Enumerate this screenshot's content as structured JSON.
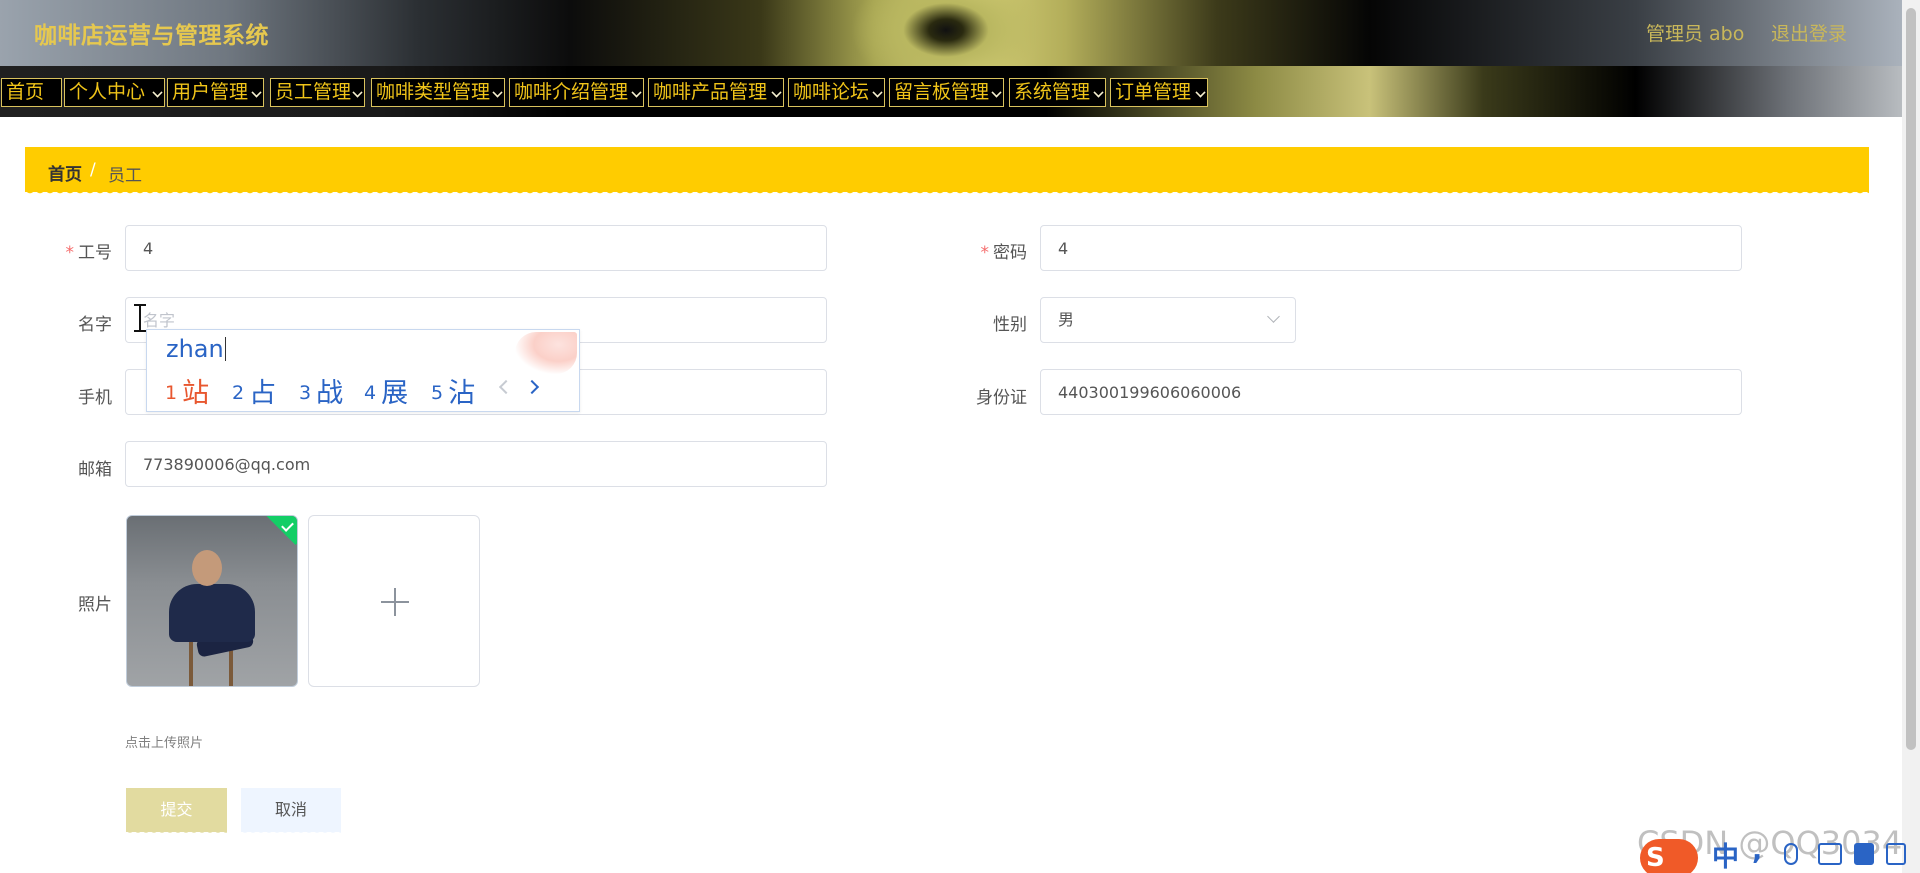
{
  "header": {
    "app_title": "咖啡店运营与管理系统",
    "admin_label": "管理员 abo",
    "logout_label": "退出登录"
  },
  "menu": {
    "items": [
      {
        "label": "首页",
        "has_dropdown": false
      },
      {
        "label": "个人中心",
        "has_dropdown": true
      },
      {
        "label": "用户管理",
        "has_dropdown": true
      },
      {
        "label": "员工管理",
        "has_dropdown": true
      },
      {
        "label": "咖啡类型管理",
        "has_dropdown": true
      },
      {
        "label": "咖啡介绍管理",
        "has_dropdown": true
      },
      {
        "label": "咖啡产品管理",
        "has_dropdown": true
      },
      {
        "label": "咖啡论坛",
        "has_dropdown": true
      },
      {
        "label": "留言板管理",
        "has_dropdown": true
      },
      {
        "label": "系统管理",
        "has_dropdown": true
      },
      {
        "label": "订单管理",
        "has_dropdown": true
      }
    ]
  },
  "breadcrumb": {
    "home": "首页",
    "separator": "/",
    "current": "员工"
  },
  "form": {
    "employee_id": {
      "label": "工号",
      "required": true,
      "value": "4"
    },
    "password": {
      "label": "密码",
      "required": true,
      "value": "4"
    },
    "name": {
      "label": "名字",
      "required": false,
      "value": "",
      "placeholder": "名字"
    },
    "gender": {
      "label": "性别",
      "value": "男"
    },
    "phone": {
      "label": "手机",
      "value": ""
    },
    "id_card": {
      "label": "身份证",
      "value": "440300199606060006"
    },
    "email": {
      "label": "邮箱",
      "value": "773890006@qq.com"
    },
    "photo": {
      "label": "照片",
      "upload_tip": "点击上传照片"
    },
    "submit_label": "提交",
    "cancel_label": "取消"
  },
  "ime": {
    "pinyin": "zhan",
    "candidates": [
      {
        "num": "1",
        "char": "站"
      },
      {
        "num": "2",
        "char": "占"
      },
      {
        "num": "3",
        "char": "战"
      },
      {
        "num": "4",
        "char": "展"
      },
      {
        "num": "5",
        "char": "沾"
      }
    ]
  },
  "watermark": "CSDN @QQ3034",
  "taskbar": {
    "sogou_logo": "S",
    "lang_label": "中"
  },
  "colors": {
    "accent": "#ffcc00",
    "menu_text": "#f0c419",
    "header_title": "#e6c84f",
    "submit_bg": "#e2dba0",
    "ime_blue": "#2a64c5",
    "ime_first": "#e8572f",
    "success": "#13ce66"
  },
  "icons": [
    "chevron-down-icon",
    "plus-icon",
    "check-icon",
    "chevron-left-icon",
    "chevron-right-icon",
    "text-cursor-icon"
  ]
}
